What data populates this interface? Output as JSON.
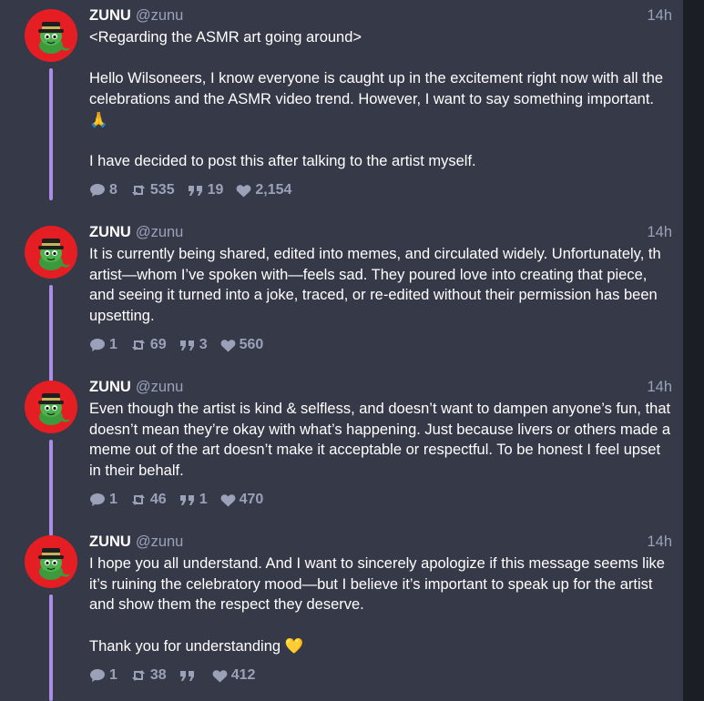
{
  "posts": [
    {
      "name": "ZUNU",
      "handle": "@zunu",
      "time": "14h",
      "body": "<Regarding the ASMR art going around>\n\nHello Wilsoneers, I know everyone is caught up in the excitement right now with all the celebrations and the ASMR video trend. However, I want to say something important. 🙏\n\nI have decided to post this after talking to the artist myself.",
      "replies": "8",
      "reposts": "535",
      "quotes": "19",
      "likes": "2,154"
    },
    {
      "name": "ZUNU",
      "handle": "@zunu",
      "time": "14h",
      "body": "It is currently being shared, edited into memes, and circulated widely. Unfortunately, th artist—whom I’ve spoken with—feels sad. They poured love into creating that piece, and seeing it turned into a joke, traced, or re-edited without their permission has been upsetting.",
      "replies": "1",
      "reposts": "69",
      "quotes": "3",
      "likes": "560"
    },
    {
      "name": "ZUNU",
      "handle": "@zunu",
      "time": "14h",
      "body": "Even though the artist is kind & selfless, and doesn’t want to dampen anyone’s fun, that doesn’t mean they’re okay with what’s happening. Just because livers or others made a meme out of the art doesn’t make it acceptable or respectful. To be honest I feel upset in their behalf.",
      "replies": "1",
      "reposts": "46",
      "quotes": "1",
      "likes": "470"
    },
    {
      "name": "ZUNU",
      "handle": "@zunu",
      "time": "14h",
      "body": "I hope you all understand. And I want to sincerely apologize if this message seems like it’s ruining the celebratory mood—but I believe it’s important to speak up for the artist and show them the respect they deserve.\n\nThank you for understanding 💛",
      "replies": "1",
      "reposts": "38",
      "quotes": "",
      "likes": "412"
    }
  ],
  "colors": {
    "background": "#363947",
    "thread_line": "#a98ee6",
    "avatar_bg": "#e51e24",
    "muted_text": "#9ba1b8"
  },
  "icons": [
    "reply-icon",
    "repost-icon",
    "quote-icon",
    "like-icon"
  ]
}
